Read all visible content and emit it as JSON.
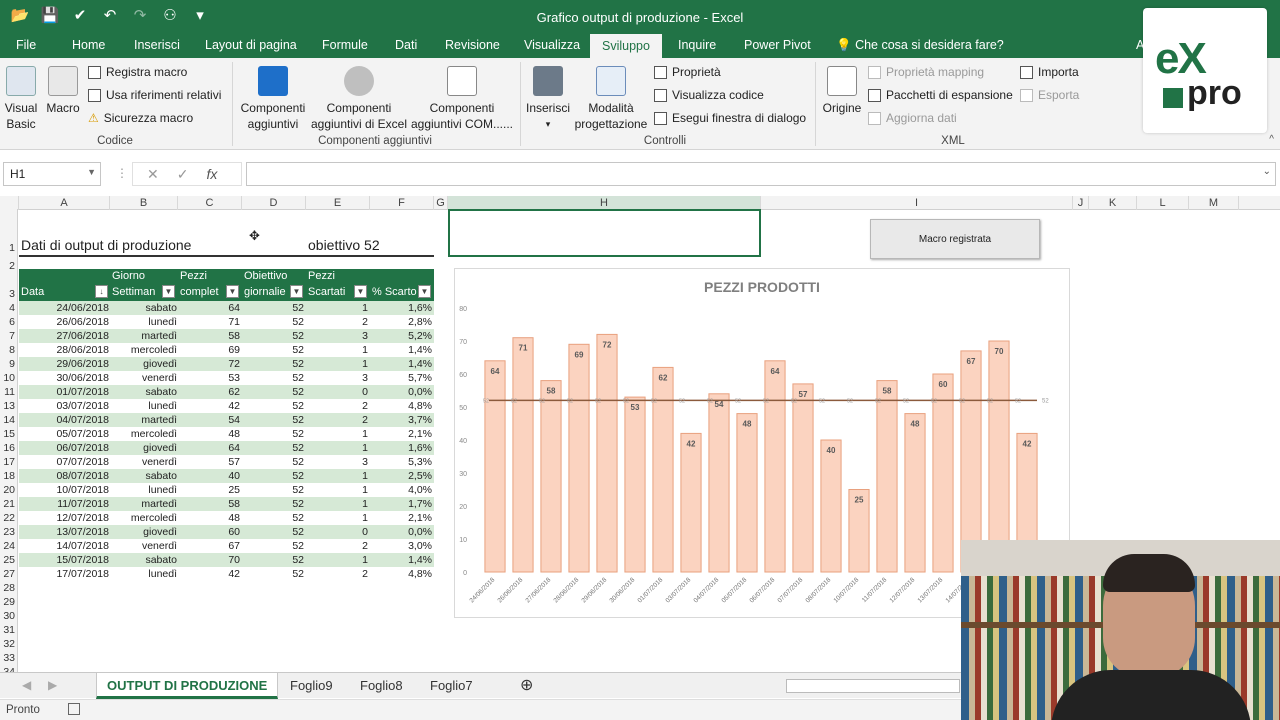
{
  "window": {
    "title": "Grafico output di produzione - Excel",
    "user_partial": "Ad",
    "restore_icon": "restore-icon",
    "min": "—",
    "max": "☐",
    "close": "✕"
  },
  "menu": {
    "tabs": [
      "File",
      "Home",
      "Inserisci",
      "Layout di pagina",
      "Formule",
      "Dati",
      "Revisione",
      "Visualizza",
      "Sviluppo",
      "Inquire",
      "Power Pivot"
    ],
    "active": "Sviluppo",
    "tell_me": "Che cosa si desidera fare?"
  },
  "ribbon": {
    "codice": {
      "group": "Codice",
      "visual_basic": "Visual\nBasic",
      "macro": "Macro",
      "registra_macro": "Registra macro",
      "usa_riferimenti": "Usa riferimenti relativi",
      "sicurezza": "Sicurezza macro"
    },
    "componenti": {
      "group": "Componenti aggiuntivi",
      "comp": "Componenti\naggiuntivi",
      "comp_excel": "Componenti\naggiuntivi di Excel",
      "comp_com": "Componenti\naggiuntivi COM......"
    },
    "controlli": {
      "group": "Controlli",
      "inserisci": "Inserisci",
      "modalita": "Modalità\nprogettazione",
      "proprieta": "Proprietà",
      "visualizza_codice": "Visualizza codice",
      "esegui": "Esegui finestra di dialogo"
    },
    "xml": {
      "group": "XML",
      "origine": "Origine",
      "proprieta_mapping": "Proprietà mapping",
      "pacchetti": "Pacchetti di espansione",
      "aggiorna": "Aggiorna dati",
      "importa": "Importa",
      "esporta": "Esporta"
    }
  },
  "formula": {
    "namebox": "H1",
    "value": ""
  },
  "columns": [
    "A",
    "B",
    "C",
    "D",
    "E",
    "F",
    "G",
    "H",
    "I",
    "J",
    "K",
    "L",
    "M"
  ],
  "sheet": {
    "title": "Dati di output di produzione",
    "goal": "obiettivo 52",
    "macro_button": "Macro registrata",
    "headers": [
      {
        "l1": "",
        "l2": "Data"
      },
      {
        "l1": "Giorno",
        "l2": "Settiman"
      },
      {
        "l1": "Pezzi",
        "l2": "complet"
      },
      {
        "l1": "Obiettivo",
        "l2": "giornalie"
      },
      {
        "l1": "Pezzi",
        "l2": "Scartati"
      },
      {
        "l1": "",
        "l2": "% Scarto"
      }
    ],
    "row_numbers": [
      "1",
      "2",
      "3",
      "4",
      "6",
      "7",
      "8",
      "9",
      "10",
      "11",
      "13",
      "14",
      "15",
      "16",
      "17",
      "18",
      "20",
      "21",
      "22",
      "23",
      "24",
      "25",
      "27",
      "28",
      "29",
      "30",
      "31",
      "32",
      "33",
      "34"
    ],
    "rows": [
      [
        "24/06/2018",
        "sabato",
        "64",
        "52",
        "1",
        "1,6%"
      ],
      [
        "26/06/2018",
        "lunedì",
        "71",
        "52",
        "2",
        "2,8%"
      ],
      [
        "27/06/2018",
        "martedì",
        "58",
        "52",
        "3",
        "5,2%"
      ],
      [
        "28/06/2018",
        "mercoledì",
        "69",
        "52",
        "1",
        "1,4%"
      ],
      [
        "29/06/2018",
        "giovedì",
        "72",
        "52",
        "1",
        "1,4%"
      ],
      [
        "30/06/2018",
        "venerdì",
        "53",
        "52",
        "3",
        "5,7%"
      ],
      [
        "01/07/2018",
        "sabato",
        "62",
        "52",
        "0",
        "0,0%"
      ],
      [
        "03/07/2018",
        "lunedì",
        "42",
        "52",
        "2",
        "4,8%"
      ],
      [
        "04/07/2018",
        "martedì",
        "54",
        "52",
        "2",
        "3,7%"
      ],
      [
        "05/07/2018",
        "mercoledì",
        "48",
        "52",
        "1",
        "2,1%"
      ],
      [
        "06/07/2018",
        "giovedì",
        "64",
        "52",
        "1",
        "1,6%"
      ],
      [
        "07/07/2018",
        "venerdì",
        "57",
        "52",
        "3",
        "5,3%"
      ],
      [
        "08/07/2018",
        "sabato",
        "40",
        "52",
        "1",
        "2,5%"
      ],
      [
        "10/07/2018",
        "lunedì",
        "25",
        "52",
        "1",
        "4,0%"
      ],
      [
        "11/07/2018",
        "martedì",
        "58",
        "52",
        "1",
        "1,7%"
      ],
      [
        "12/07/2018",
        "mercoledì",
        "48",
        "52",
        "1",
        "2,1%"
      ],
      [
        "13/07/2018",
        "giovedì",
        "60",
        "52",
        "0",
        "0,0%"
      ],
      [
        "14/07/2018",
        "venerdì",
        "67",
        "52",
        "2",
        "3,0%"
      ],
      [
        "15/07/2018",
        "sabato",
        "70",
        "52",
        "1",
        "1,4%"
      ],
      [
        "17/07/2018",
        "lunedì",
        "42",
        "52",
        "2",
        "4,8%"
      ]
    ]
  },
  "chart_data": {
    "type": "bar",
    "title": "PEZZI PRODOTTI",
    "categories": [
      "24/06/2018",
      "26/06/2018",
      "27/06/2018",
      "28/06/2018",
      "29/06/2018",
      "30/06/2018",
      "01/07/2018",
      "03/07/2018",
      "04/07/2018",
      "05/07/2018",
      "06/07/2018",
      "07/07/2018",
      "08/07/2018",
      "10/07/2018",
      "11/07/2018",
      "12/07/2018",
      "13/07/2018",
      "14/07/2018",
      "15/07/2018",
      "17/07/2018"
    ],
    "values": [
      64,
      71,
      58,
      69,
      72,
      53,
      62,
      42,
      54,
      48,
      64,
      57,
      40,
      25,
      58,
      48,
      60,
      67,
      70,
      42
    ],
    "target": 52,
    "ylim": [
      0,
      80
    ],
    "yticks": [
      0,
      10,
      20,
      30,
      40,
      50,
      60,
      70,
      80
    ],
    "bar_fill": "#fbd3c0",
    "bar_stroke": "#e8a07e",
    "target_color": "#8b5a3c"
  },
  "tabs": {
    "sheets": [
      "OUTPUT DI PRODUZIONE",
      "Foglio9",
      "Foglio8",
      "Foglio7"
    ],
    "add": "⊕"
  },
  "status": {
    "text": "Pronto"
  },
  "logo": {
    "text1": "eX",
    "text2": "pro"
  },
  "colors": {
    "excel_green": "#217346",
    "band": "#d6e9d6"
  }
}
